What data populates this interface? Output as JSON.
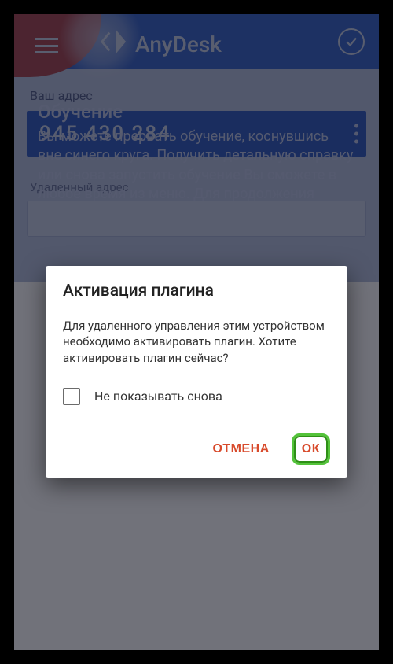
{
  "header": {
    "brand": "AnyDesk"
  },
  "app": {
    "address_label": "Ваш адрес",
    "address_value": "945 430 284",
    "other_label": "Удаленный адрес"
  },
  "tutorial": {
    "title": "Обучение",
    "body": "Вы можете прервать обучение, коснувшись вне синего круга. Получить детальную справку или снова запустить обучение Вы сможете в любое время из меню. Для продолжения"
  },
  "dialog": {
    "title": "Активация плагина",
    "body": "Для удаленного управления этим устройством необходимо активировать плагин. Хотите активировать плагин сейчас?",
    "checkbox_label": "Не показывать снова",
    "cancel": "ОТМЕНА",
    "ok": "ОК"
  }
}
